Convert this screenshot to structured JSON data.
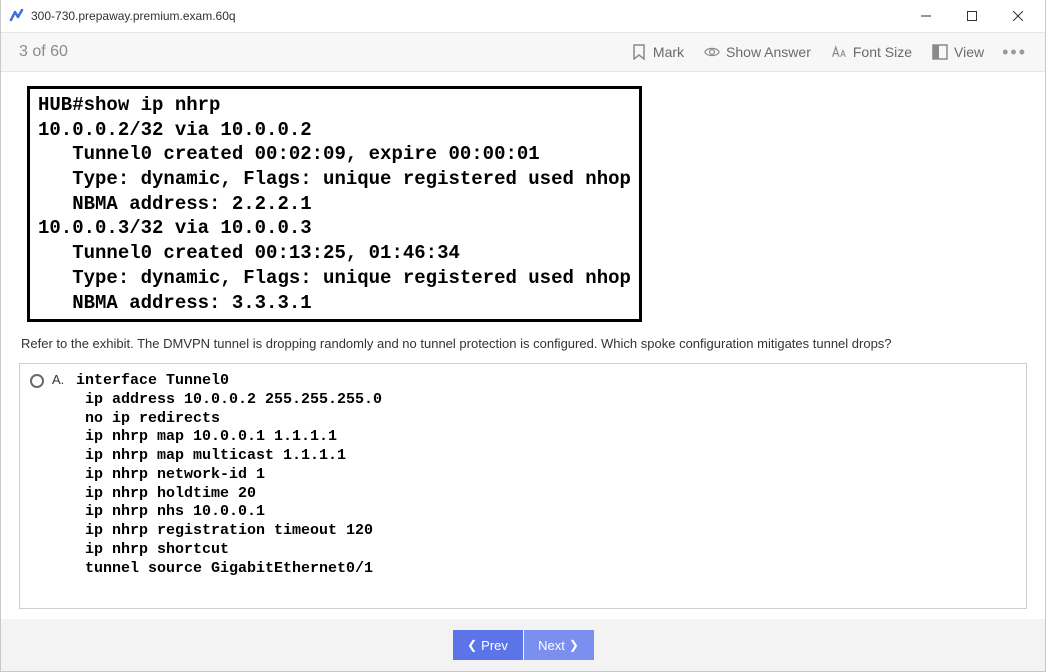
{
  "window": {
    "title": "300-730.prepaway.premium.exam.60q"
  },
  "toolbar": {
    "progress": "3 of 60",
    "mark": "Mark",
    "show_answer": "Show Answer",
    "font_size": "Font Size",
    "view": "View"
  },
  "exhibit": "HUB#show ip nhrp\n10.0.0.2/32 via 10.0.0.2\n   Tunnel0 created 00:02:09, expire 00:00:01\n   Type: dynamic, Flags: unique registered used nhop\n   NBMA address: 2.2.2.1\n10.0.0.3/32 via 10.0.0.3\n   Tunnel0 created 00:13:25, 01:46:34\n   Type: dynamic, Flags: unique registered used nhop\n   NBMA address: 3.3.3.1",
  "question": "Refer to the exhibit. The DMVPN tunnel is dropping randomly and no tunnel protection is configured. Which spoke configuration mitigates tunnel drops?",
  "options": {
    "a": {
      "letter": "A.",
      "code": "interface Tunnel0\n ip address 10.0.0.2 255.255.255.0\n no ip redirects\n ip nhrp map 10.0.0.1 1.1.1.1\n ip nhrp map multicast 1.1.1.1\n ip nhrp network-id 1\n ip nhrp holdtime 20\n ip nhrp nhs 10.0.0.1\n ip nhrp registration timeout 120\n ip nhrp shortcut\n tunnel source GigabitEthernet0/1"
    }
  },
  "footer": {
    "prev": "Prev",
    "next": "Next"
  }
}
